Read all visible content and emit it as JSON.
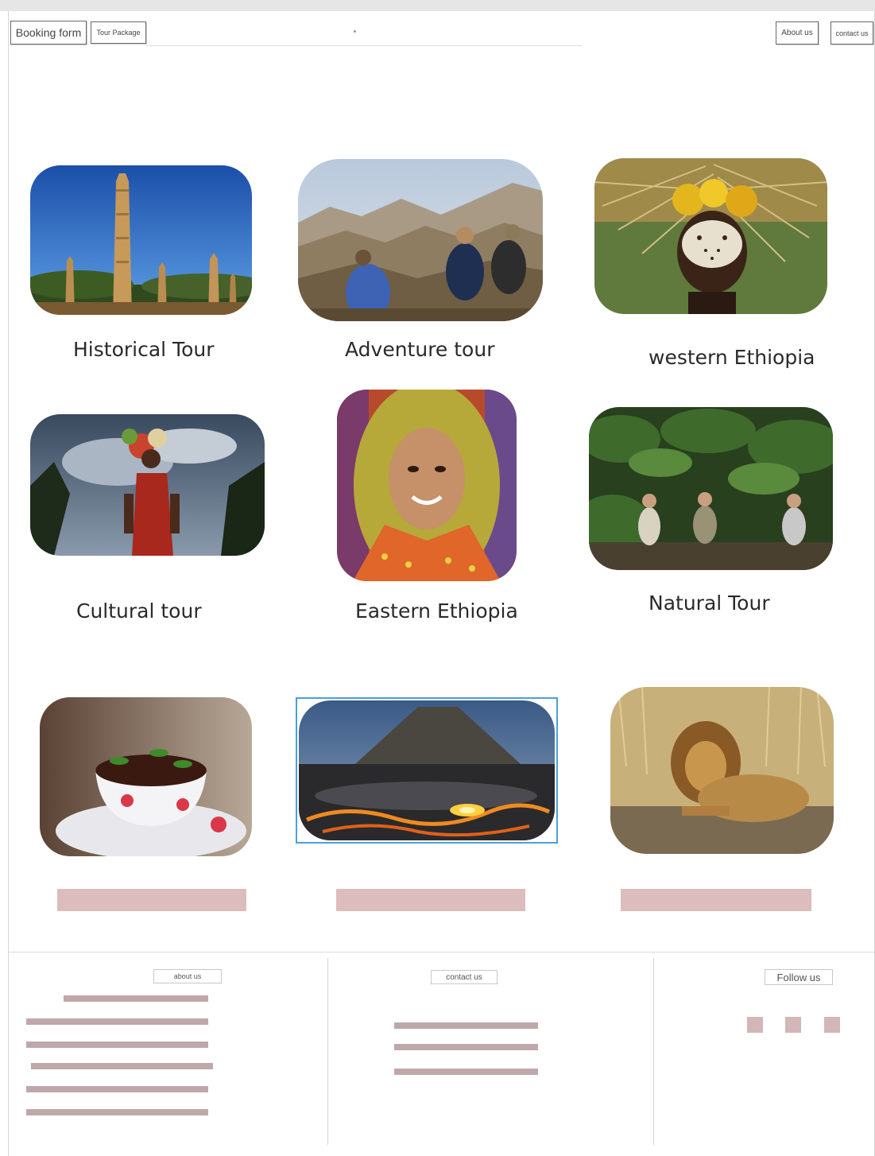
{
  "nav": {
    "booking": "Booking form",
    "tour_package": "Tour Package",
    "about": "About us",
    "contact": "contact us"
  },
  "tours": [
    {
      "title": "Historical Tour",
      "image": "obelisk-photo"
    },
    {
      "title": "Adventure tour",
      "image": "mountain-hikers-photo"
    },
    {
      "title": "western Ethiopia",
      "image": "flower-headdress-photo"
    },
    {
      "title": "Cultural tour",
      "image": "tribal-person-photo"
    },
    {
      "title": "Eastern Ethiopia",
      "image": "harari-woman-photo"
    },
    {
      "title": "Natural Tour",
      "image": "forest-hikers-photo"
    },
    {
      "title": "",
      "image": "coffee-cup-photo"
    },
    {
      "title": "",
      "image": "lava-lake-photo"
    },
    {
      "title": "",
      "image": "lion-photo"
    }
  ],
  "footer": {
    "about": "about us",
    "contact": "contact us",
    "follow": "Follow us"
  },
  "colors": {
    "placeholder_bar": "#dcbcbc",
    "footer_line": "#bfa8aa",
    "social_square": "#d3b6b8",
    "selection_border": "#4a9fdc"
  }
}
